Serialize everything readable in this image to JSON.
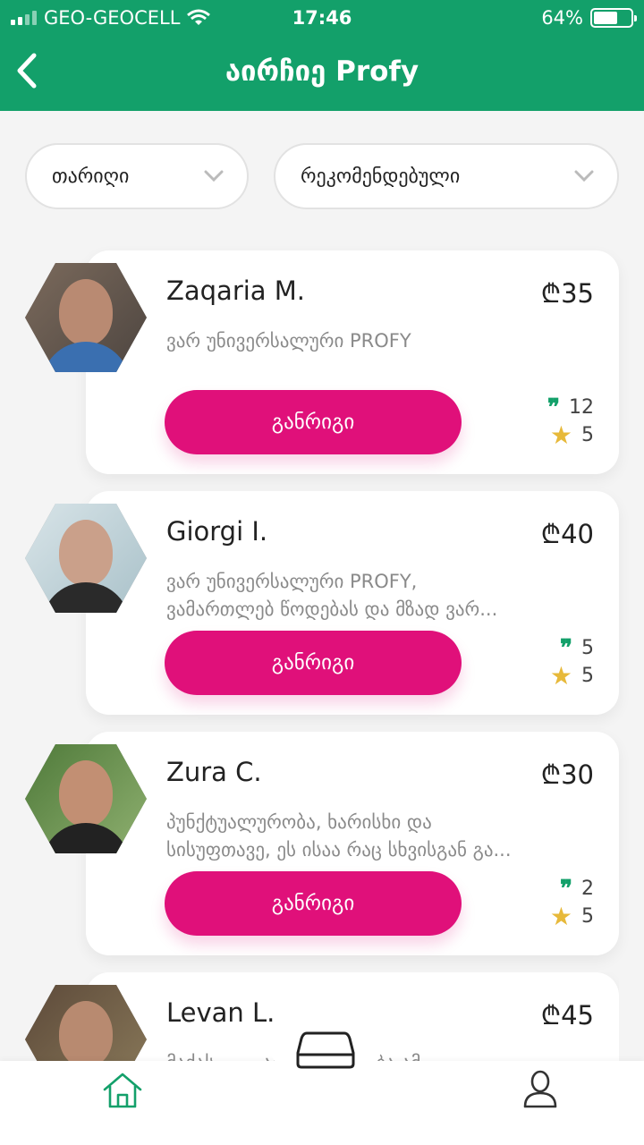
{
  "status_bar": {
    "carrier": "GEO-GEOCELL",
    "time": "17:46",
    "battery": "64%",
    "battery_level": 0.64
  },
  "header": {
    "title": "აირჩიე Profy"
  },
  "filters": {
    "date": "თარიღი",
    "sort": "რეკომენდებული"
  },
  "pros": [
    {
      "name": "Zaqaria M.",
      "price": "₾35",
      "desc_line1": "ვარ უნივერსალური PROFY",
      "desc_line2": "",
      "button": "განრიგი",
      "reviews": "12",
      "rating": "5"
    },
    {
      "name": "Giorgi I.",
      "price": "₾40",
      "desc_line1": "ვარ უნივერსალური PROFY,",
      "desc_line2": "ვამართლებ წოდებას და მზად ვარ...",
      "button": "განრიგი",
      "reviews": "5",
      "rating": "5"
    },
    {
      "name": "Zura C.",
      "price": "₾30",
      "desc_line1": "პუნქტუალურობა, ხარისხი და",
      "desc_line2": "სისუფთავე, ეს ისაა რაც სხვისგან გა...",
      "button": "განრიგი",
      "reviews": "2",
      "rating": "5"
    },
    {
      "name": "Levan L.",
      "price": "₾45",
      "desc_line1": "მაქას ... ...ამოთლილობა ამ",
      "desc_line2": "",
      "button": "",
      "reviews": "",
      "rating": ""
    }
  ],
  "nav": {
    "home": "home-icon",
    "center": "mattress-icon",
    "profile": "user-icon"
  },
  "colors": {
    "brand": "#13a06a",
    "accent": "#e0107a",
    "star": "#e7b93a"
  }
}
